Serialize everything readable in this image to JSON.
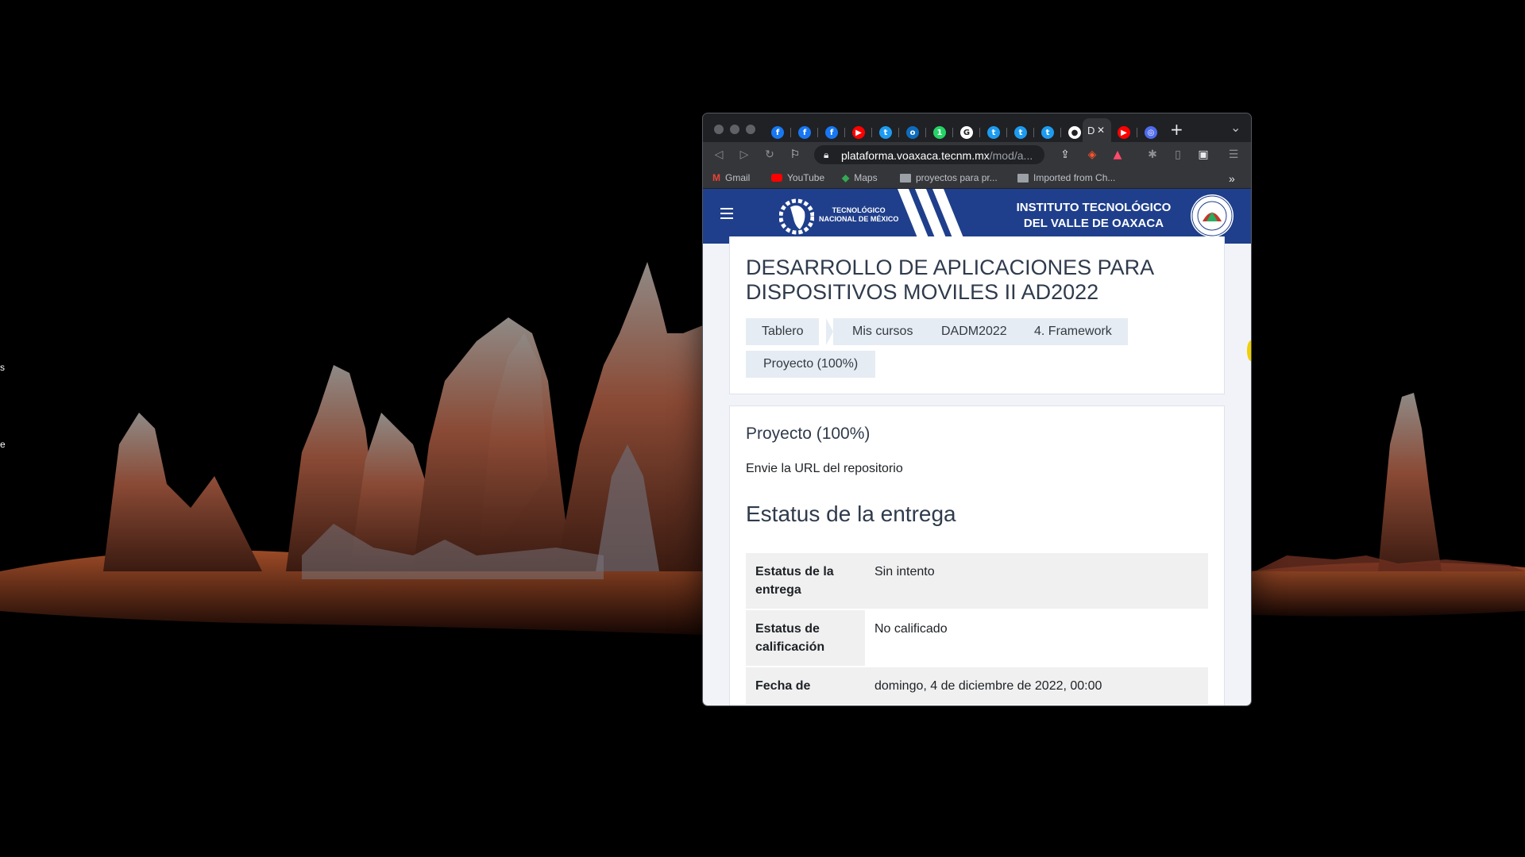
{
  "desktop": {
    "edge_fragments": [
      "s",
      "e"
    ]
  },
  "browser": {
    "tabs": [
      {
        "icon": "facebook-icon",
        "color": "#1877f2",
        "glyph": "f"
      },
      {
        "icon": "facebook-icon",
        "color": "#1877f2",
        "glyph": "f"
      },
      {
        "icon": "facebook-icon",
        "color": "#1877f2",
        "glyph": "f"
      },
      {
        "icon": "youtube-icon",
        "color": "#ff0000",
        "glyph": "▶"
      },
      {
        "icon": "twitter-icon",
        "color": "#1d9bf0",
        "glyph": "t"
      },
      {
        "icon": "outlook-icon",
        "color": "#0f6cbd",
        "glyph": "o"
      },
      {
        "icon": "whatsapp-icon",
        "color": "#25d366",
        "glyph": "1"
      },
      {
        "icon": "google-icon",
        "color": "#ffffff",
        "glyph": "G"
      },
      {
        "icon": "twitter-icon",
        "color": "#1d9bf0",
        "glyph": "t"
      },
      {
        "icon": "twitter-icon",
        "color": "#1d9bf0",
        "glyph": "t"
      },
      {
        "icon": "twitter-icon",
        "color": "#1d9bf0",
        "glyph": "t"
      },
      {
        "icon": "github-icon",
        "color": "#ffffff",
        "glyph": "●"
      },
      {
        "icon": "youtube-icon",
        "color": "#ff0000",
        "glyph": "▶"
      },
      {
        "icon": "chromium-icon",
        "color": "#4f6bed",
        "glyph": "◎"
      }
    ],
    "active_tab_label": "D",
    "active_tab_close": "✕",
    "new_tab": "+",
    "tab_list_chevron": "⌄",
    "url_domain": "plataforma.voaxaca.tecnm.mx",
    "url_path": "/mod/a...",
    "bookmarks": [
      {
        "label": "Gmail",
        "icon": "gmail-icon"
      },
      {
        "label": "YouTube",
        "icon": "youtube-icon"
      },
      {
        "label": "Maps",
        "icon": "maps-icon"
      },
      {
        "label": "proyectos para pr...",
        "icon": "folder-icon"
      },
      {
        "label": "Imported from Ch...",
        "icon": "folder-icon"
      }
    ],
    "bookmarks_overflow": "»"
  },
  "site": {
    "tecnm_text": "TECNOLÓGICO\nNACIONAL DE MÉXICO",
    "institute": "INSTITUTO TECNOLÓGICO\nDEL VALLE DE OAXACA",
    "colors": {
      "header": "#1f3f8c",
      "text": "#2f3b4c"
    }
  },
  "course": {
    "title": "DESARROLLO DE APLICACIONES PARA DISPOSITIVOS MOVILES II AD2022",
    "breadcrumbs": [
      "Tablero",
      "Mis cursos",
      "DADM2022",
      "4. Framework"
    ],
    "current": "Proyecto (100%)"
  },
  "assignment": {
    "title": "Proyecto (100%)",
    "description": "Envie la URL del repositorio",
    "status_heading": "Estatus de la entrega",
    "rows": [
      {
        "key": "Estatus de la entrega",
        "value": "Sin intento"
      },
      {
        "key": "Estatus de calificación",
        "value": "No calificado"
      },
      {
        "key": "Fecha de",
        "value": "domingo, 4 de diciembre de 2022, 00:00"
      }
    ]
  }
}
